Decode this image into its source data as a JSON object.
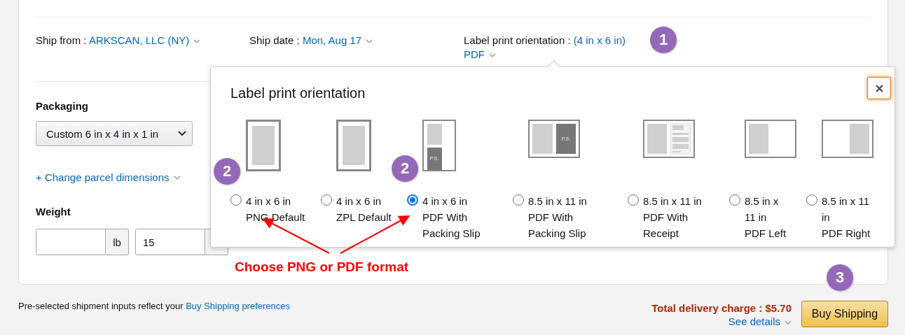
{
  "ship_info": {
    "ship_from": {
      "label": "Ship from :",
      "value": "ARKSCAN, LLC (NY)"
    },
    "ship_date": {
      "label": "Ship date :",
      "value": "Mon, Aug 17"
    },
    "label_orientation": {
      "label": "Label print orientation :",
      "value": "(4 in x 6 in)",
      "format": "PDF"
    }
  },
  "packaging": {
    "heading": "Packaging",
    "value": "Custom 6 in x 4 in x 1 in"
  },
  "change_dimensions": "+ Change parcel dimensions",
  "weight": {
    "heading": "Weight",
    "fields": [
      {
        "unit": "lb"
      },
      {
        "value": "15"
      }
    ]
  },
  "popup": {
    "title": "Label print orientation",
    "options": [
      {
        "kind": "portrait",
        "lines": [
          "4 in x 6 in",
          "PNG Default"
        ],
        "selected": false
      },
      {
        "kind": "portrait",
        "lines": [
          "4 in x 6 in",
          "ZPL Default"
        ],
        "selected": false
      },
      {
        "kind": "portrait-slip",
        "mark": "P.S.",
        "lines": [
          "4 in x 6 in",
          "PDF With",
          "Packing Slip"
        ],
        "selected": true
      },
      {
        "kind": "landscape-slip",
        "mark": "P.S.",
        "lines": [
          "8.5 in x 11 in",
          "PDF With",
          "Packing Slip"
        ],
        "selected": false
      },
      {
        "kind": "landscape-receipt",
        "lines": [
          "8.5 in x 11 in",
          "PDF With",
          "Receipt"
        ],
        "selected": false
      },
      {
        "kind": "landscape-left",
        "lines": [
          "8.5 in x",
          "11 in",
          "PDF Left"
        ],
        "selected": false
      },
      {
        "kind": "landscape-right",
        "lines": [
          "8.5 in x 11",
          "in",
          "PDF Right"
        ],
        "selected": false
      }
    ]
  },
  "footer": {
    "note": "Pre-selected shipment inputs reflect your",
    "link": "Buy Shipping preferences",
    "total": "Total delivery charge : $5.70",
    "details": "See details",
    "buy_button": "Buy Shipping"
  },
  "annotations": {
    "badges": [
      {
        "text": "1"
      },
      {
        "text": "2"
      },
      {
        "text": "2"
      },
      {
        "text": "3"
      }
    ],
    "callout": "Choose PNG or PDF format"
  }
}
